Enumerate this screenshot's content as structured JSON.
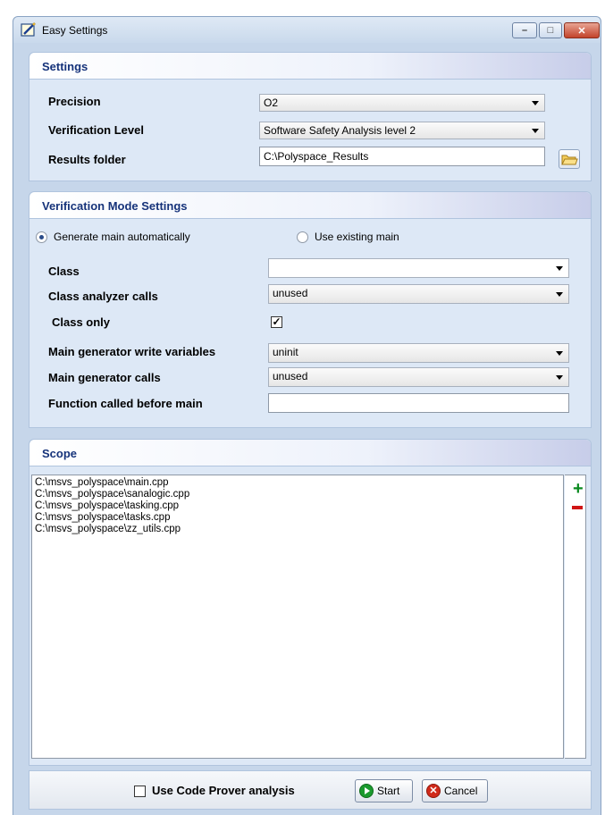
{
  "window": {
    "title": "Easy Settings",
    "minimize": "–",
    "maximize": "□",
    "close": "✕"
  },
  "settings": {
    "header": "Settings",
    "precision_label": "Precision",
    "precision_value": "O2",
    "verification_label": "Verification Level",
    "verification_value": "Software Safety Analysis level 2",
    "results_label": "Results folder",
    "results_value": "C:\\Polyspace_Results"
  },
  "vmode": {
    "header": "Verification Mode Settings",
    "radio_generate": "Generate main automatically",
    "radio_existing": "Use existing main",
    "class_label": "Class",
    "class_value": "",
    "class_analyzer_label": "Class analyzer calls",
    "class_analyzer_value": "unused",
    "class_only_label": "Class only",
    "class_only_checked": "✓",
    "write_vars_label": "Main generator write variables",
    "write_vars_value": "uninit",
    "gen_calls_label": "Main generator calls",
    "gen_calls_value": "unused",
    "func_before_label": "Function called before main",
    "func_before_value": ""
  },
  "scope": {
    "header": "Scope",
    "files": [
      "C:\\msvs_polyspace\\main.cpp",
      "C:\\msvs_polyspace\\sanalogic.cpp",
      "C:\\msvs_polyspace\\tasking.cpp",
      "C:\\msvs_polyspace\\tasks.cpp",
      "C:\\msvs_polyspace\\zz_utils.cpp"
    ],
    "add": "+"
  },
  "footer": {
    "code_prover_label": "Use Code Prover analysis",
    "start_label": "Start",
    "cancel_label": "Cancel",
    "cancel_icon": "✕"
  }
}
